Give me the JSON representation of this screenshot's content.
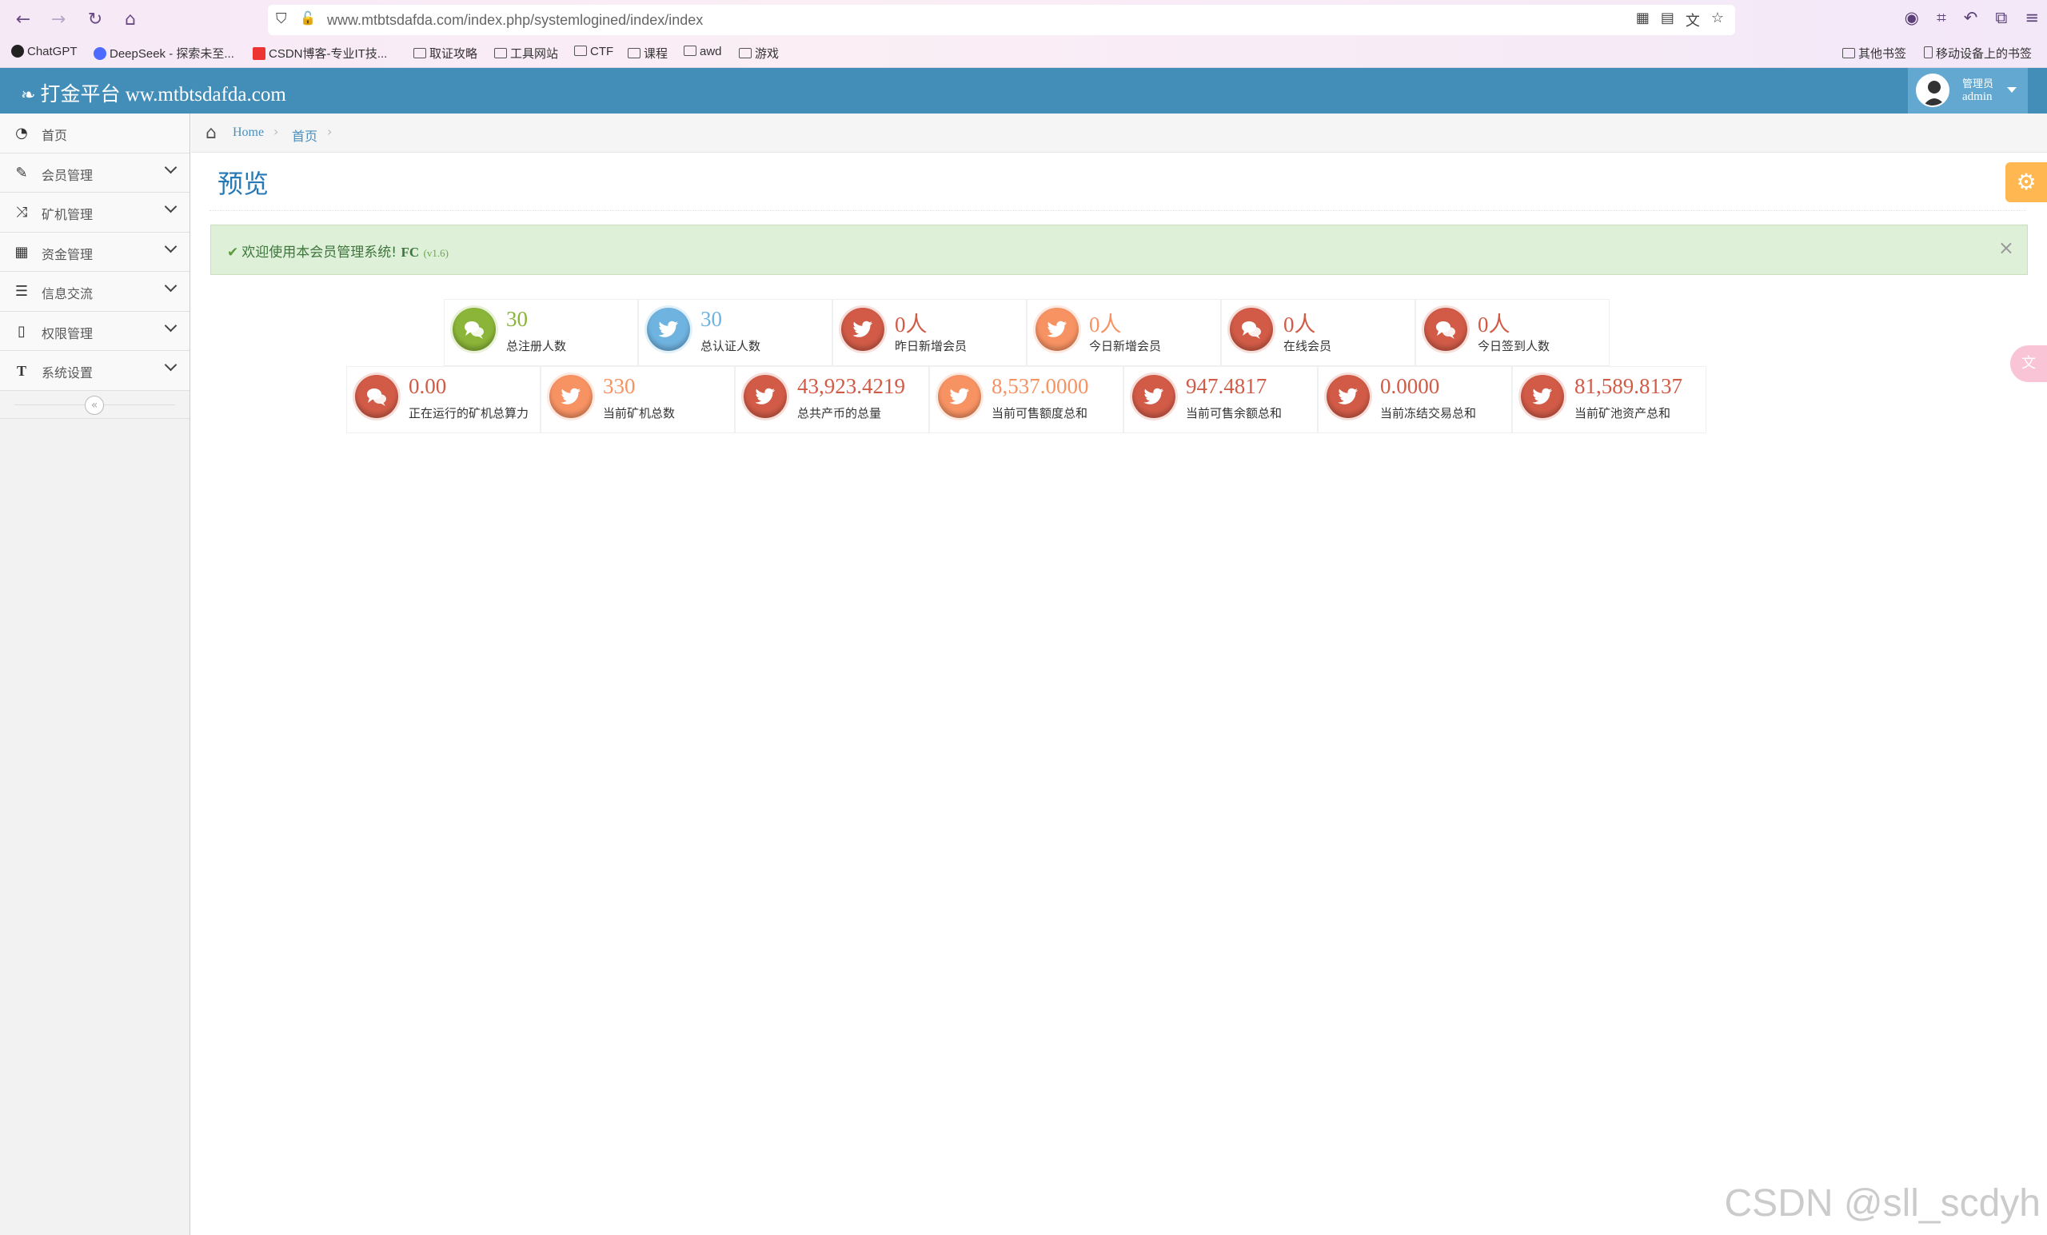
{
  "browser": {
    "url": "www.mtbtsdafda.com/index.php/systemlogined/index/index",
    "bookmarks": [
      {
        "label": "ChatGPT",
        "icon": "chatgpt-icon"
      },
      {
        "label": "DeepSeek - 探索未至...",
        "icon": "deepseek-icon"
      },
      {
        "label": "CSDN博客-专业IT技...",
        "icon": "csdn-icon"
      },
      {
        "label": "取证攻略",
        "icon": "folder-icon"
      },
      {
        "label": "工具网站",
        "icon": "folder-icon"
      },
      {
        "label": "CTF",
        "icon": "folder-icon"
      },
      {
        "label": "课程",
        "icon": "folder-icon"
      },
      {
        "label": "awd",
        "icon": "folder-icon"
      },
      {
        "label": "游戏",
        "icon": "folder-icon"
      }
    ],
    "other_bookmarks": "其他书签",
    "mobile_bookmarks": "移动设备上的书签"
  },
  "header": {
    "brand": "打金平台 ww.mtbtsdafda.com",
    "user_role": "管理员",
    "user_name": "admin"
  },
  "sidebar": {
    "items": [
      {
        "label": "首页",
        "icon": "dashboard-icon"
      },
      {
        "label": "会员管理",
        "icon": "edit-icon"
      },
      {
        "label": "矿机管理",
        "icon": "shuffle-icon"
      },
      {
        "label": "资金管理",
        "icon": "calendar-icon"
      },
      {
        "label": "信息交流",
        "icon": "list-icon"
      },
      {
        "label": "权限管理",
        "icon": "file-icon"
      },
      {
        "label": "系统设置",
        "icon": "text-icon"
      }
    ]
  },
  "breadcrumb": {
    "home": "Home",
    "current": "首页"
  },
  "page": {
    "title": "预览"
  },
  "alert": {
    "text": "欢迎使用本会员管理系统!",
    "brand": "FC",
    "version": "(v1.6)"
  },
  "stats_row1": [
    {
      "value": "30",
      "label": "总注册人数",
      "color": "#8ab538",
      "icon": "comments-icon"
    },
    {
      "value": "30",
      "label": "总认证人数",
      "color": "#6fb3e0",
      "icon": "twitter-icon"
    },
    {
      "value": "0人",
      "label": "昨日新增会员",
      "color": "#d15b47",
      "icon": "twitter-icon"
    },
    {
      "value": "0人",
      "label": "今日新增会员",
      "color": "#f79263",
      "icon": "twitter-icon"
    },
    {
      "value": "0人",
      "label": "在线会员",
      "color": "#d15b47",
      "icon": "comments-icon"
    },
    {
      "value": "0人",
      "label": "今日签到人数",
      "color": "#d15b47",
      "icon": "comments-icon"
    }
  ],
  "stats_row2": [
    {
      "value": "0.00",
      "label": "正在运行的矿机总算力",
      "color": "#d15b47",
      "icon": "comments-icon"
    },
    {
      "value": "330",
      "label": "当前矿机总数",
      "color": "#f79263",
      "icon": "twitter-icon"
    },
    {
      "value": "43,923.4219",
      "label": "总共产币的总量",
      "color": "#d15b47",
      "icon": "twitter-icon"
    },
    {
      "value": "8,537.0000",
      "label": "当前可售额度总和",
      "color": "#f79263",
      "icon": "twitter-icon"
    },
    {
      "value": "947.4817",
      "label": "当前可售余额总和",
      "color": "#d15b47",
      "icon": "twitter-icon"
    },
    {
      "value": "0.0000",
      "label": "当前冻结交易总和",
      "color": "#d15b47",
      "icon": "twitter-icon"
    },
    {
      "value": "81,589.8137",
      "label": "当前矿池资产总和",
      "color": "#d15b47",
      "icon": "twitter-icon"
    }
  ],
  "watermark": "CSDN @sll_scdyh"
}
